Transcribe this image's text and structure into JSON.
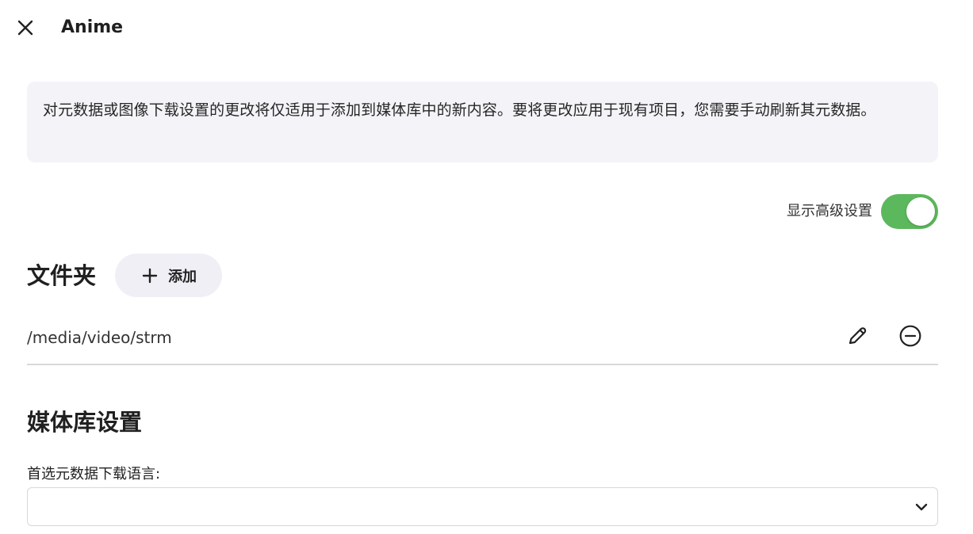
{
  "header": {
    "title": "Anime",
    "close_icon": "close-icon"
  },
  "notice": {
    "text": "对元数据或图像下载设置的更改将仅适用于添加到媒体库中的新内容。要将更改应用于现有项目，您需要手动刷新其元数据。"
  },
  "advanced": {
    "label": "显示高级设置",
    "enabled": true,
    "accent": "#5cb85c"
  },
  "folders": {
    "title": "文件夹",
    "add_label": "添加",
    "add_icon": "plus-icon",
    "items": [
      {
        "path": "/media/video/strm",
        "edit_icon": "pencil-icon",
        "remove_icon": "minus-circle-icon"
      }
    ]
  },
  "library": {
    "title": "媒体库设置",
    "metadata_language_label": "首选元数据下载语言:",
    "metadata_language_value": "",
    "chevron_icon": "chevron-down-icon"
  }
}
